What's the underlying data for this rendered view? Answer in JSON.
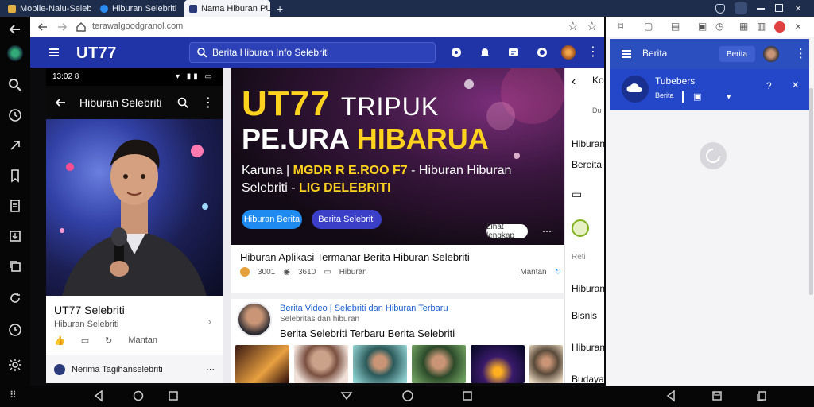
{
  "tabs": [
    {
      "label": "Mobile-Nalu-Selebriti"
    },
    {
      "label": "Hiburan Selebriti"
    },
    {
      "label": "Nama Hiburan PUSA"
    }
  ],
  "browser": {
    "url": "terawalgoodgranol.com"
  },
  "site": {
    "brand": "UT77",
    "search_placeholder": "Berita Hiburan Info Selebriti"
  },
  "phone": {
    "status_time": "13:02 8",
    "app_title": "Hiburan Selebriti",
    "profile_name": "UT77 Selebriti",
    "profile_handle": "Hiburan Selebriti",
    "profile_more": "Mantan",
    "card_name": "Nerima Tagihanselebriti"
  },
  "hero": {
    "line1_a": "UT77",
    "line1_b": "TRIPUK",
    "line2_a": "PE.URA",
    "line2_b": "HIBARUA",
    "sub1_a": "Karuna |",
    "sub1_b": "MGDR R E.ROO F7",
    "sub1_c": "- Hiburan Hiburan",
    "sub2_a": "Selebriti -",
    "sub2_b": "LIG DELEBRITI",
    "btn_primary": "Hiburan Berita",
    "btn_secondary": "Berita Selebriti",
    "more": "Lihat lengkap"
  },
  "content": {
    "title": "Hiburan Aplikasi Termanar Berita Hiburan Selebriti",
    "meta_a": "3001",
    "meta_b": "3610",
    "meta_c": "Hiburan",
    "meta_d": "Mantan",
    "post_title": "Berita Video | Selebriti dan Hiburan Terbaru",
    "post_sub": "Selebritas dan hiburan",
    "post_body": "Berita Selebriti Terbaru Berita Selebriti"
  },
  "rpanel": {
    "l1": "Ko",
    "l1b": "Du",
    "l2": "Hiburan",
    "l3": "Bereita",
    "l4": "Reti",
    "l5": "Hiburan",
    "l6": "Bisnis",
    "l7": "Hiburan",
    "l8": "Budaya"
  },
  "rwin": {
    "bar_title": "Berita",
    "bar_btn": "Berita",
    "card_title": "Tubebers",
    "card_sub": "Berita"
  },
  "colors": {
    "brand": "#2034a8",
    "accent": "#ffd21e",
    "btn_primary": "#1f8bf0",
    "btn_secondary": "#3b3fc7"
  }
}
